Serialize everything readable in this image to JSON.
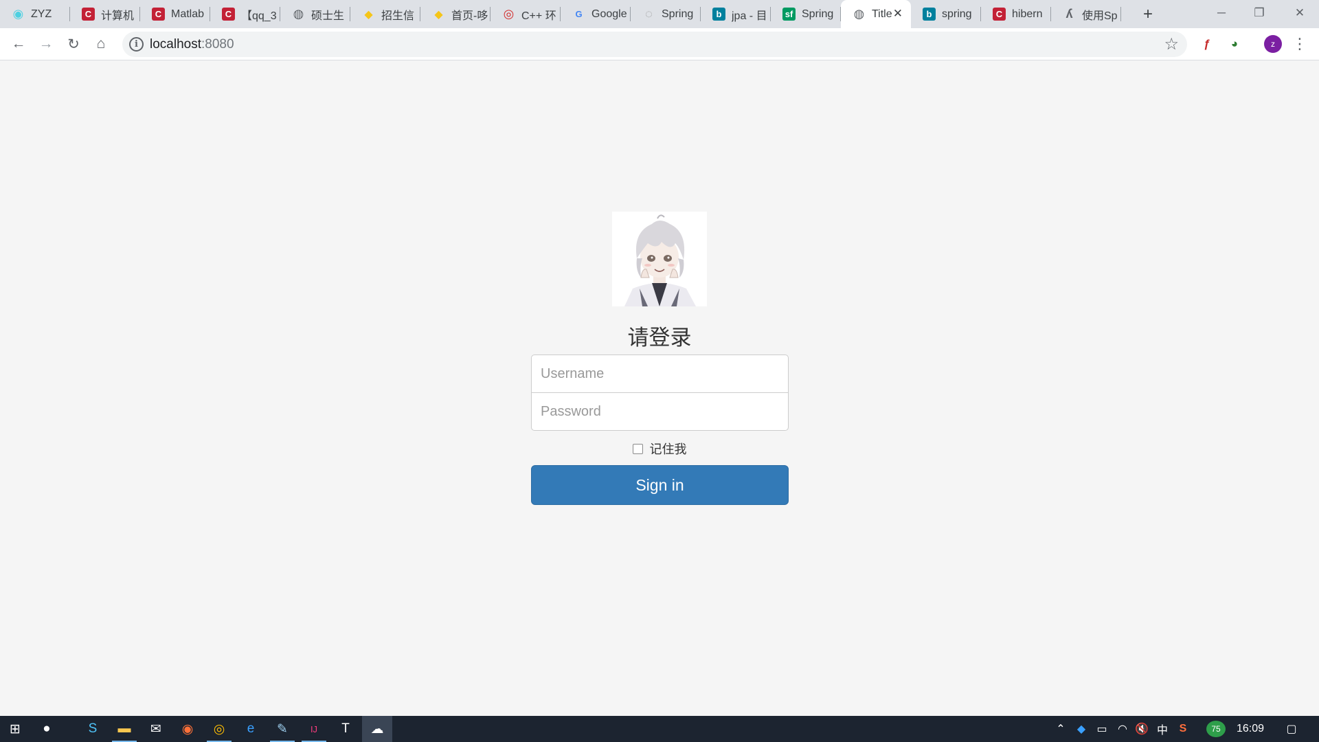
{
  "tabs": [
    {
      "title": "ZYZ",
      "icon": "globe-teal-icon",
      "color": "#4dd0e1",
      "glyph": "◉"
    },
    {
      "title": "计算机",
      "icon": "csdn-icon",
      "color": "#c32136",
      "glyph": "C"
    },
    {
      "title": "Matlab",
      "icon": "csdn-icon",
      "color": "#c32136",
      "glyph": "C"
    },
    {
      "title": "【qq_3",
      "icon": "csdn-icon",
      "color": "#c32136",
      "glyph": "C"
    },
    {
      "title": "硕士生",
      "icon": "globe-icon",
      "color": "#5f6368",
      "glyph": "◍"
    },
    {
      "title": "招生信",
      "icon": "python-icon",
      "color": "#3776ab",
      "glyph": "◆"
    },
    {
      "title": "首页-哆",
      "icon": "python-icon",
      "color": "#3776ab",
      "glyph": "◆"
    },
    {
      "title": "C++ 环",
      "icon": "owl-icon",
      "color": "#d32f2f",
      "glyph": "◎"
    },
    {
      "title": "Google",
      "icon": "google-translate-icon",
      "color": "#4285f4",
      "glyph": "G"
    },
    {
      "title": "Spring",
      "icon": "spring-icon",
      "color": "#9e9e9e",
      "glyph": "◌"
    },
    {
      "title": "jpa - 目",
      "icon": "bing-icon",
      "color": "#00809d",
      "glyph": "b"
    },
    {
      "title": "Spring",
      "icon": "segmentfault-icon",
      "color": "#009a61",
      "glyph": "sf"
    },
    {
      "title": "Title",
      "icon": "globe-icon",
      "color": "#5f6368",
      "glyph": "◍",
      "active": true
    },
    {
      "title": "spring",
      "icon": "bing-icon",
      "color": "#00809d",
      "glyph": "b"
    },
    {
      "title": "hibern",
      "icon": "csdn-icon",
      "color": "#c32136",
      "glyph": "C"
    },
    {
      "title": "使用Sp",
      "icon": "zhihu-icon",
      "color": "#5f6368",
      "glyph": "ʎ"
    }
  ],
  "tab_close": "✕",
  "new_tab": "+",
  "window": {
    "minimize": "─",
    "restore": "❐",
    "close": "✕"
  },
  "toolbar": {
    "back": "←",
    "forward": "→",
    "reload": "↻",
    "home": "⌂",
    "info_glyph": "i",
    "url_host": "localhost",
    "url_port": ":8080",
    "bookmark": "☆",
    "extensions": [
      {
        "name": "flash-icon",
        "glyph": "ƒ",
        "color": "#c62828"
      },
      {
        "name": "globe-extension-icon",
        "glyph": "◕",
        "color": "#2e7d32"
      }
    ],
    "profile_initial": "z",
    "menu": "⋮"
  },
  "page": {
    "heading": "请登录",
    "username_placeholder": "Username",
    "password_placeholder": "Password",
    "remember_label": "记住我",
    "signin_label": "Sign in",
    "accent": "#337ab7"
  },
  "taskbar": {
    "apps": [
      {
        "name": "start-icon",
        "glyph": "⊞"
      },
      {
        "name": "cortana-icon",
        "glyph": "●"
      },
      {
        "name": "sogou-browser-icon",
        "glyph": "S"
      },
      {
        "name": "file-explorer-icon",
        "glyph": "▬",
        "running": true
      },
      {
        "name": "mail-icon",
        "glyph": "✉"
      },
      {
        "name": "firefox-icon",
        "glyph": "◉"
      },
      {
        "name": "chrome-icon",
        "glyph": "◎",
        "running": true
      },
      {
        "name": "edge-icon",
        "glyph": "e"
      },
      {
        "name": "notepad-icon",
        "glyph": "✎",
        "running": true
      },
      {
        "name": "intellij-icon",
        "glyph": "IJ",
        "running": true
      },
      {
        "name": "typora-icon",
        "glyph": "T"
      },
      {
        "name": "cloud-app-icon",
        "glyph": "☁",
        "active": true
      }
    ],
    "tray": [
      {
        "name": "tray-chevron-icon",
        "glyph": "⌃"
      },
      {
        "name": "shield-tray-icon",
        "glyph": "◆"
      },
      {
        "name": "battery-icon",
        "glyph": "▭"
      },
      {
        "name": "wifi-icon",
        "glyph": "◠"
      },
      {
        "name": "volume-muted-icon",
        "glyph": "🔇"
      },
      {
        "name": "ime-label",
        "glyph": "中"
      },
      {
        "name": "sogou-ime-icon",
        "glyph": "S"
      },
      {
        "name": "cpu-badge",
        "glyph": "75"
      }
    ],
    "time": "16:09",
    "notifications": "▢"
  }
}
